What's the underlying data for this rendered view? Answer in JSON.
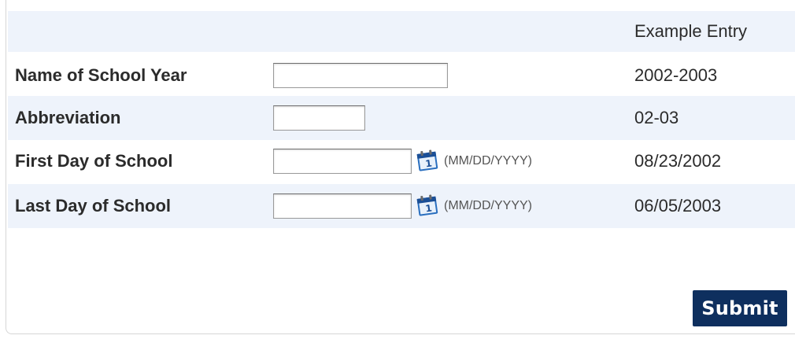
{
  "header": {
    "example_heading": "Example Entry"
  },
  "rows": [
    {
      "label": "Name of School Year",
      "value": "",
      "example": "2002-2003",
      "has_calendar": false
    },
    {
      "label": "Abbreviation",
      "value": "",
      "example": "02-03",
      "has_calendar": false
    },
    {
      "label": "First Day of School",
      "value": "",
      "example": "08/23/2002",
      "has_calendar": true,
      "format_hint": "(MM/DD/YYYY)"
    },
    {
      "label": "Last Day of School",
      "value": "",
      "example": "06/05/2003",
      "has_calendar": true,
      "format_hint": "(MM/DD/YYYY)"
    }
  ],
  "icons": {
    "calendar": "calendar-icon"
  },
  "submit": {
    "label": "Submit"
  },
  "colors": {
    "row_shade": "#eef3fb",
    "submit_bg": "#0e2f5e",
    "calendar_blue": "#2a6fbf"
  }
}
